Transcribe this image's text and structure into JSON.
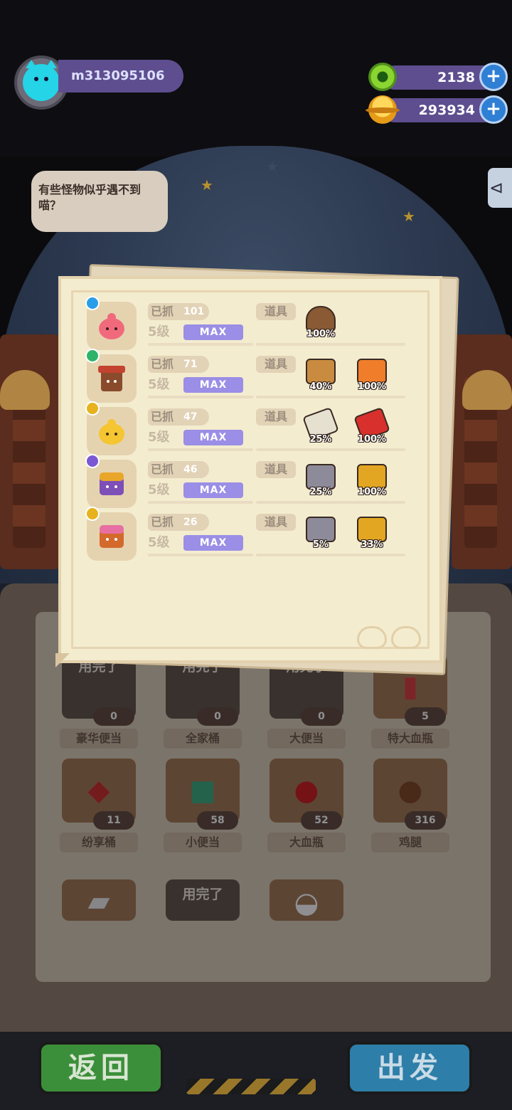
{
  "player": {
    "name": "m313095106",
    "avatar_icon": "cat-avatar-icon"
  },
  "currency": {
    "gems": {
      "value": "2138",
      "icon": "green-ring-gem-icon"
    },
    "coins": {
      "value": "293934",
      "icon": "planet-coin-icon"
    },
    "plus_label": "+"
  },
  "speech": {
    "text": "有些怪物似乎遇不到喵？"
  },
  "catch_panel": {
    "caught_label": "已抓",
    "items_label": "道具",
    "rows": [
      {
        "monster": "pink-slime",
        "badge_color": "#2a9de8",
        "caught": "101",
        "level": "5级",
        "status": "MAX",
        "items": [
          {
            "icon": "helmet-icon",
            "color": "#8a5a34",
            "percent": "100%"
          }
        ]
      },
      {
        "monster": "red-box-monster",
        "badge_color": "#2fb36a",
        "caught": "71",
        "level": "5级",
        "status": "MAX",
        "items": [
          {
            "icon": "cardboard-box-icon",
            "color": "#c98b3f",
            "percent": "40%"
          },
          {
            "icon": "orange-box-icon",
            "color": "#f07d2a",
            "percent": "100%"
          }
        ]
      },
      {
        "monster": "yellow-slime",
        "badge_color": "#e7b21d",
        "caught": "47",
        "level": "5级",
        "status": "MAX",
        "items": [
          {
            "icon": "paper-tag-icon",
            "color": "#e6e0d0",
            "percent": "25%"
          },
          {
            "icon": "red-tag-icon",
            "color": "#d8302c",
            "percent": "100%"
          }
        ]
      },
      {
        "monster": "purple-chest-monster",
        "badge_color": "#7a58d4",
        "caught": "46",
        "level": "5级",
        "status": "MAX",
        "items": [
          {
            "icon": "gray-case-icon",
            "color": "#8d8a99",
            "percent": "25%"
          },
          {
            "icon": "gold-case-icon",
            "color": "#e2a623",
            "percent": "100%"
          }
        ]
      },
      {
        "monster": "pink-chest-monster",
        "badge_color": "#e7b21d",
        "caught": "26",
        "level": "5级",
        "status": "MAX",
        "items": [
          {
            "icon": "gray-case-icon",
            "color": "#8d8a99",
            "percent": "5%"
          },
          {
            "icon": "gold-case-icon",
            "color": "#e2a623",
            "percent": "33%"
          }
        ]
      }
    ]
  },
  "inventory": [
    {
      "name": "豪华便当",
      "count": "0",
      "used": "用完了"
    },
    {
      "name": "全家桶",
      "count": "0",
      "used": "用完了"
    },
    {
      "name": "大便当",
      "count": "0",
      "used": "用完了"
    },
    {
      "name": "特大血瓶",
      "count": "5",
      "used": ""
    },
    {
      "name": "纷享桶",
      "count": "11",
      "used": ""
    },
    {
      "name": "小便当",
      "count": "58",
      "used": ""
    },
    {
      "name": "大血瓶",
      "count": "52",
      "used": ""
    },
    {
      "name": "鸡腿",
      "count": "316",
      "used": ""
    },
    {
      "name": "",
      "count": "",
      "used": ""
    },
    {
      "name": "",
      "count": "",
      "used": "用完了"
    },
    {
      "name": "",
      "count": "",
      "used": ""
    }
  ],
  "buttons": {
    "back": "返回",
    "go": "出发"
  }
}
